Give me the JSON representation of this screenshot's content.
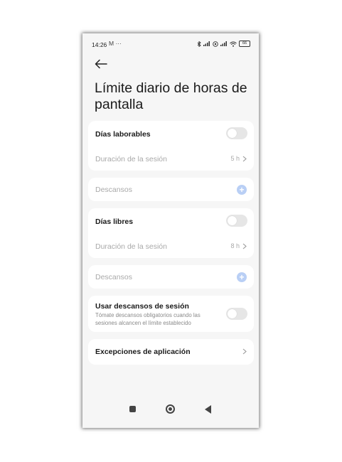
{
  "status_bar": {
    "time": "14:26",
    "extra": "M ···",
    "battery": "66"
  },
  "header": {
    "title": "Límite diario de horas de pantalla"
  },
  "workdays": {
    "label": "Días laborables",
    "session_label": "Duración de la sesión",
    "session_value": "5 h",
    "breaks_label": "Descansos"
  },
  "freedays": {
    "label": "Días libres",
    "session_label": "Duración de la sesión",
    "session_value": "8 h",
    "breaks_label": "Descansos"
  },
  "session_breaks": {
    "label": "Usar descansos de sesión",
    "description": "Tómate descansos obligatorios cuando las sesiones alcancen el límite establecido"
  },
  "exceptions": {
    "label": "Excepciones de aplicación"
  },
  "colors": {
    "background": "#f6f6f6",
    "card": "#ffffff",
    "accent_plus": "#b9cff5",
    "toggle_off": "#e6e6e6"
  }
}
